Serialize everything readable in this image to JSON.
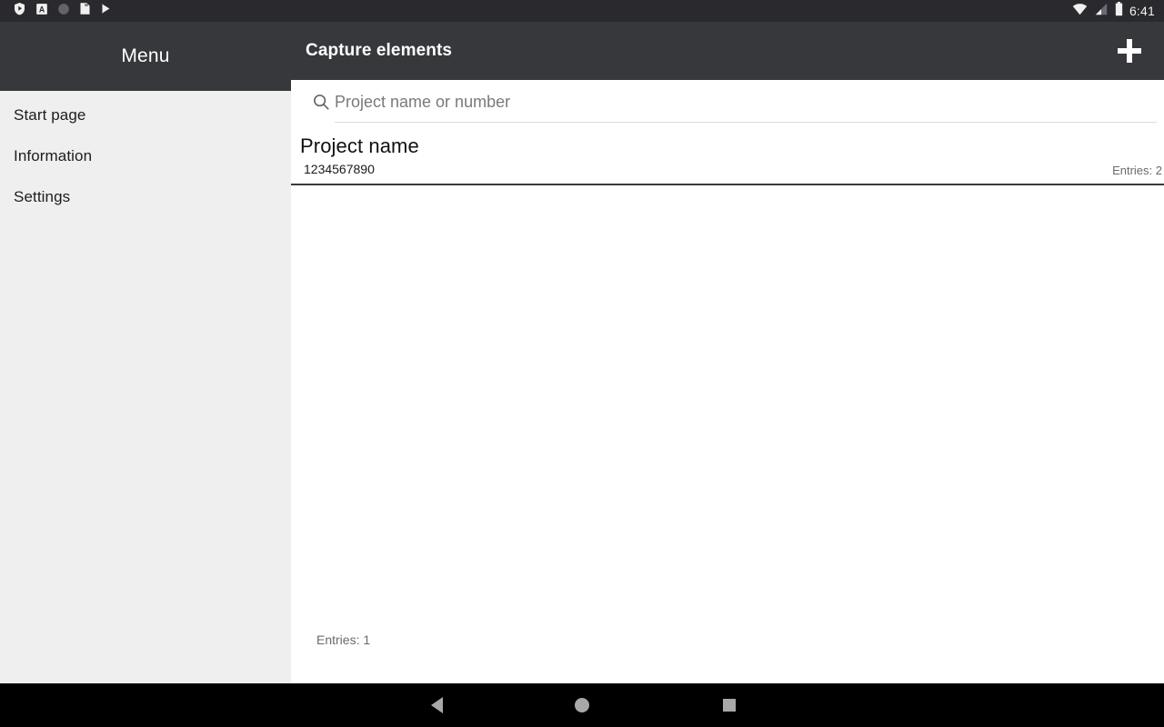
{
  "status_bar": {
    "time": "6:41",
    "left_icons": [
      "play-protect-shield-icon",
      "adaway-letter-a-icon",
      "gray-circle-icon",
      "sd-card-icon",
      "play-store-icon"
    ],
    "right_icons": [
      "wifi-icon",
      "cellular-signal-icon",
      "battery-icon"
    ]
  },
  "app_bar": {
    "title": "Capture elements",
    "add_button_label": "+",
    "background_color": "#37383c"
  },
  "drawer": {
    "header_title": "Menu",
    "items": [
      {
        "label": "Start page"
      },
      {
        "label": "Information"
      },
      {
        "label": "Settings"
      }
    ],
    "background_color": "#efefef"
  },
  "content": {
    "search": {
      "placeholder": "Project name or number",
      "value": "",
      "icon": "search-icon"
    },
    "list": {
      "rows": [
        {
          "name": "Project name",
          "number": "1234567890",
          "entries": "Entries: 2"
        }
      ]
    },
    "footer_entries": "Entries: 1"
  },
  "nav_bar": {
    "back": "back-icon",
    "home": "home-icon",
    "recents": "recents-icon"
  }
}
